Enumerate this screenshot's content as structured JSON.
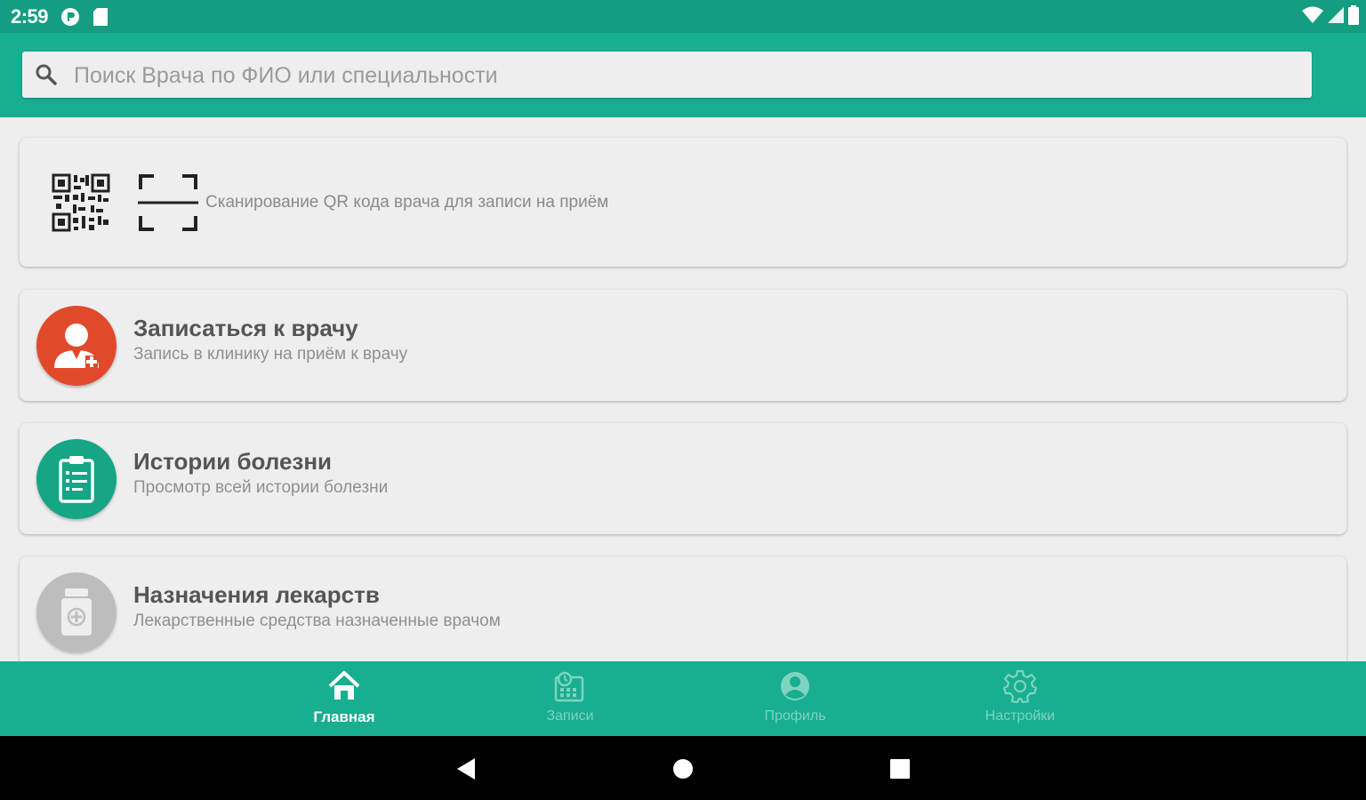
{
  "status_bar": {
    "time": "2:59"
  },
  "search": {
    "placeholder": "Поиск Врача по ФИО или специальности"
  },
  "qr_card": {
    "text": "Сканирование QR кода врача для записи на приём"
  },
  "menu": [
    {
      "title": "Записаться к врачу",
      "subtitle": "Запись в клинику на приём к врачу"
    },
    {
      "title": "Истории болезни",
      "subtitle": "Просмотр всей истории болезни"
    },
    {
      "title": "Назначения лекарств",
      "subtitle": "Лекарственные средства назначенные врачом"
    }
  ],
  "bottom_nav": [
    {
      "label": "Главная",
      "icon": "home-icon",
      "active": true
    },
    {
      "label": "Записи",
      "icon": "appointments-icon",
      "active": false
    },
    {
      "label": "Профиль",
      "icon": "profile-icon",
      "active": false
    },
    {
      "label": "Настройки",
      "icon": "settings-icon",
      "active": false
    }
  ],
  "colors": {
    "status_bar": "#149d80",
    "primary": "#18ae90",
    "appointment_icon_bg": "#e2492a",
    "history_icon_bg": "#16a585",
    "meds_icon_bg": "#bdbdbd",
    "inactive_nav": "#7fd3c1"
  }
}
